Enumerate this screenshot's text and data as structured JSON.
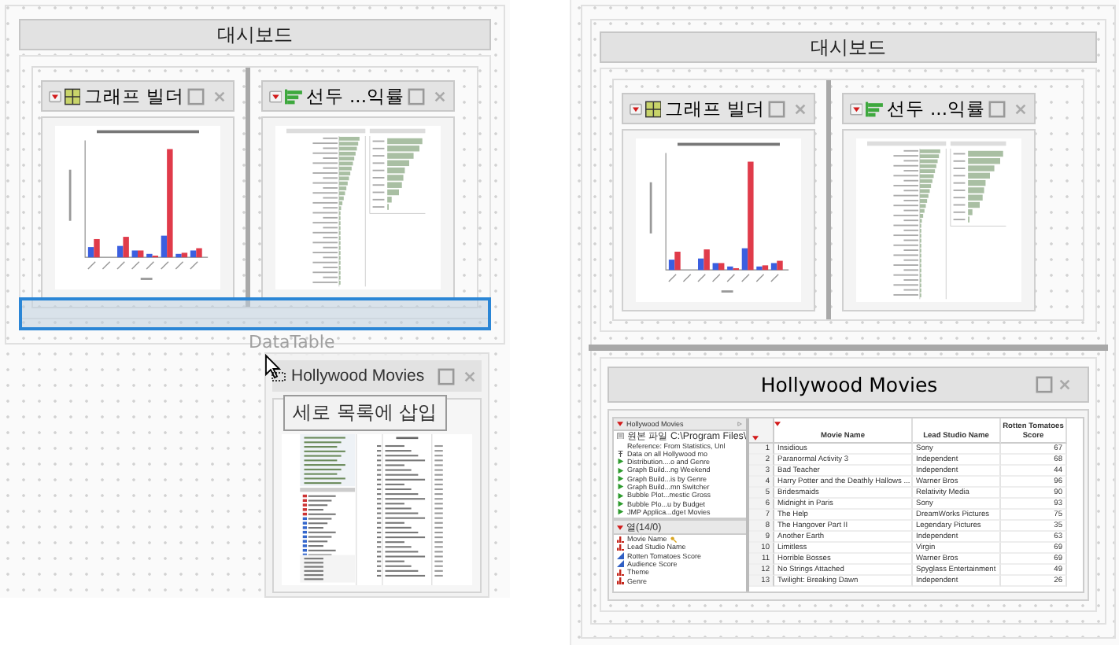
{
  "left_canvas": {
    "dashboard_title": "대시보드",
    "panels": [
      {
        "kind": "graph",
        "title": "그래프 빌더"
      },
      {
        "kind": "bars",
        "title": "선두 ...익률"
      }
    ],
    "drag_label": "DataTable",
    "dragged_window": {
      "title": "Hollywood Movies",
      "tooltip": "세로 목록에 삽입"
    }
  },
  "right_canvas": {
    "dashboard_title": "대시보드",
    "panels": [
      {
        "kind": "graph",
        "title": "그래프 빌더"
      },
      {
        "kind": "bars",
        "title": "선두 ...익률"
      }
    ],
    "data_table": {
      "title": "Hollywood Movies",
      "table_panel": {
        "title": "Hollywood Movies",
        "items": [
          {
            "kind": "note",
            "text": "원본 파일 C:\\Program Files\\"
          },
          {
            "kind": "text",
            "text": "Reference: From Statistics, Unl"
          },
          {
            "kind": "pin",
            "text": "Data on all Hollywood mo"
          },
          {
            "kind": "script",
            "text": "Distribution....o and Genre"
          },
          {
            "kind": "script",
            "text": "Graph Build...ng Weekend"
          },
          {
            "kind": "script",
            "text": "Graph Build...is by Genre"
          },
          {
            "kind": "script",
            "text": "Graph Build...mn Switcher"
          },
          {
            "kind": "script",
            "text": "Bubble Plot...mestic Gross"
          },
          {
            "kind": "script",
            "text": "Bubble Plo...u by Budget"
          },
          {
            "kind": "script",
            "text": "JMP Applica...dget Movies"
          }
        ]
      },
      "columns_panel": {
        "title": "열(14/0)",
        "columns": [
          {
            "name": "Movie Name",
            "kind": "nominal",
            "key": true
          },
          {
            "name": "Lead Studio Name",
            "kind": "nominal",
            "key": false
          },
          {
            "name": "Rotten Tomatoes Score",
            "kind": "continuous",
            "key": false
          },
          {
            "name": "Audience Score",
            "kind": "continuous",
            "key": false
          },
          {
            "name": "Theme",
            "kind": "nominal",
            "key": false
          },
          {
            "name": "Genre",
            "kind": "nominal",
            "key": false
          }
        ]
      },
      "grid": {
        "columns": [
          "Movie Name",
          "Lead Studio Name",
          "Rotten Tomatoes Score"
        ],
        "rows": [
          {
            "number": "1",
            "cells": [
              "Insidious",
              "Sony",
              "67"
            ]
          },
          {
            "number": "2",
            "cells": [
              "Paranormal Activity 3",
              "Independent",
              "68"
            ]
          },
          {
            "number": "3",
            "cells": [
              "Bad Teacher",
              "Independent",
              "44"
            ]
          },
          {
            "number": "4",
            "cells": [
              "Harry Potter and the Deathly Hallows ...",
              "Warner Bros",
              "96"
            ]
          },
          {
            "number": "5",
            "cells": [
              "Bridesmaids",
              "Relativity Media",
              "90"
            ]
          },
          {
            "number": "6",
            "cells": [
              "Midnight in Paris",
              "Sony",
              "93"
            ]
          },
          {
            "number": "7",
            "cells": [
              "The Help",
              "DreamWorks Pictures",
              "75"
            ]
          },
          {
            "number": "8",
            "cells": [
              "The Hangover Part II",
              "Legendary Pictures",
              "35"
            ]
          },
          {
            "number": "9",
            "cells": [
              "Another Earth",
              "Independent",
              "63"
            ]
          },
          {
            "number": "10",
            "cells": [
              "Limitless",
              "Virgin",
              "69"
            ]
          },
          {
            "number": "11",
            "cells": [
              "Horrible Bosses",
              "Warner Bros",
              "69"
            ]
          },
          {
            "number": "12",
            "cells": [
              "No Strings Attached",
              "Spyglass Entertainment",
              "49"
            ]
          },
          {
            "number": "13",
            "cells": [
              "Twilight: Breaking Dawn",
              "Independent",
              "26"
            ]
          }
        ]
      }
    }
  }
}
